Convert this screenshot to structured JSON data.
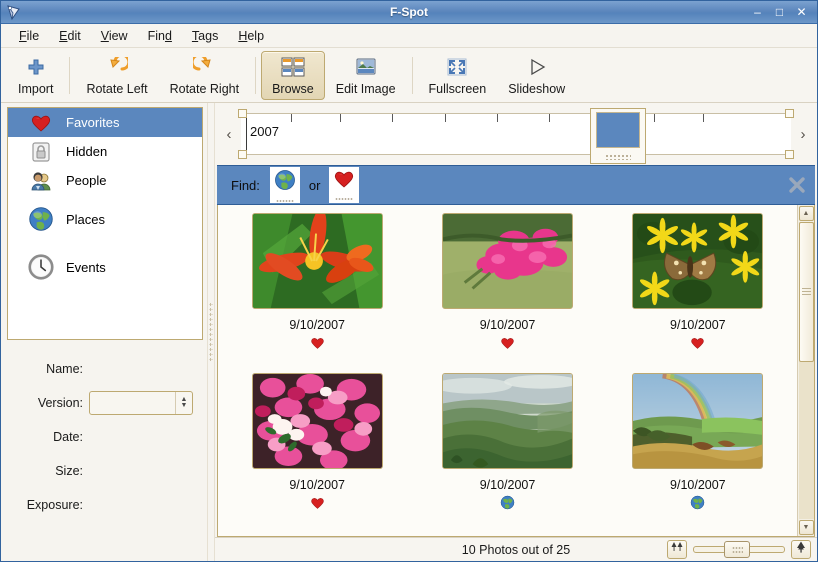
{
  "window": {
    "title": "F-Spot",
    "icon": "fspot-logo-icon",
    "minimize": "–",
    "maximize": "□",
    "close": "✕"
  },
  "menubar": {
    "items": [
      {
        "label": "File",
        "accel": "F"
      },
      {
        "label": "Edit",
        "accel": "E"
      },
      {
        "label": "View",
        "accel": "V"
      },
      {
        "label": "Find",
        "accel": "d"
      },
      {
        "label": "Tags",
        "accel": "T"
      },
      {
        "label": "Help",
        "accel": "H"
      }
    ]
  },
  "toolbar": {
    "buttons": [
      {
        "label": "Import",
        "icon": "plus-icon",
        "active": false
      },
      {
        "label": "Rotate Left",
        "icon": "rotate-left-icon",
        "active": false
      },
      {
        "label": "Rotate Right",
        "icon": "rotate-right-icon",
        "active": false
      },
      {
        "label": "Browse",
        "icon": "browse-grid-icon",
        "active": true
      },
      {
        "label": "Edit Image",
        "icon": "edit-image-icon",
        "active": false
      },
      {
        "label": "Fullscreen",
        "icon": "fullscreen-icon",
        "active": false
      },
      {
        "label": "Slideshow",
        "icon": "slideshow-play-icon",
        "active": false
      }
    ]
  },
  "sidebar": {
    "tags": [
      {
        "label": "Favorites",
        "icon": "heart-icon",
        "selected": true
      },
      {
        "label": "Hidden",
        "icon": "lock-icon",
        "selected": false
      },
      {
        "label": "People",
        "icon": "people-icon",
        "selected": false
      },
      {
        "label": "Places",
        "icon": "globe-icon",
        "selected": false
      },
      {
        "label": "Events",
        "icon": "clock-icon",
        "selected": false
      }
    ],
    "metadata": [
      {
        "label": "Name:",
        "value": ""
      },
      {
        "label": "Version:",
        "value": ""
      },
      {
        "label": "Date:",
        "value": ""
      },
      {
        "label": "Size:",
        "value": ""
      },
      {
        "label": "Exposure:",
        "value": ""
      }
    ],
    "version_value": ""
  },
  "timeline": {
    "year": "2007",
    "prev_arrow": "‹",
    "next_arrow": "›"
  },
  "findbar": {
    "label": "Find:",
    "or_label": "or",
    "terms": [
      {
        "icon": "globe-icon"
      },
      {
        "icon": "heart-icon"
      }
    ],
    "close_icon": "close-icon",
    "background_color": "#5b87be"
  },
  "photos": [
    {
      "date": "9/10/2007",
      "tag_icon": "heart-icon",
      "image": "orange-lily-flower"
    },
    {
      "date": "9/10/2007",
      "tag_icon": "heart-icon",
      "image": "pink-blossom-bush"
    },
    {
      "date": "9/10/2007",
      "tag_icon": "heart-icon",
      "image": "butterfly-yellow-flowers"
    },
    {
      "date": "9/10/2007",
      "tag_icon": "heart-icon",
      "image": "pink-white-flower-bed"
    },
    {
      "date": "9/10/2007",
      "tag_icon": "globe-icon",
      "image": "green-hills-landscape"
    },
    {
      "date": "9/10/2007",
      "tag_icon": "globe-icon",
      "image": "rainbow-over-fields"
    }
  ],
  "statusbar": {
    "text": "10 Photos out of 25",
    "zoom_out_icon": "two-trees-icon",
    "zoom_in_icon": "one-tree-icon"
  },
  "scrollbar": {
    "up_icon": "chevron-up-icon",
    "down_icon": "chevron-down-icon"
  }
}
